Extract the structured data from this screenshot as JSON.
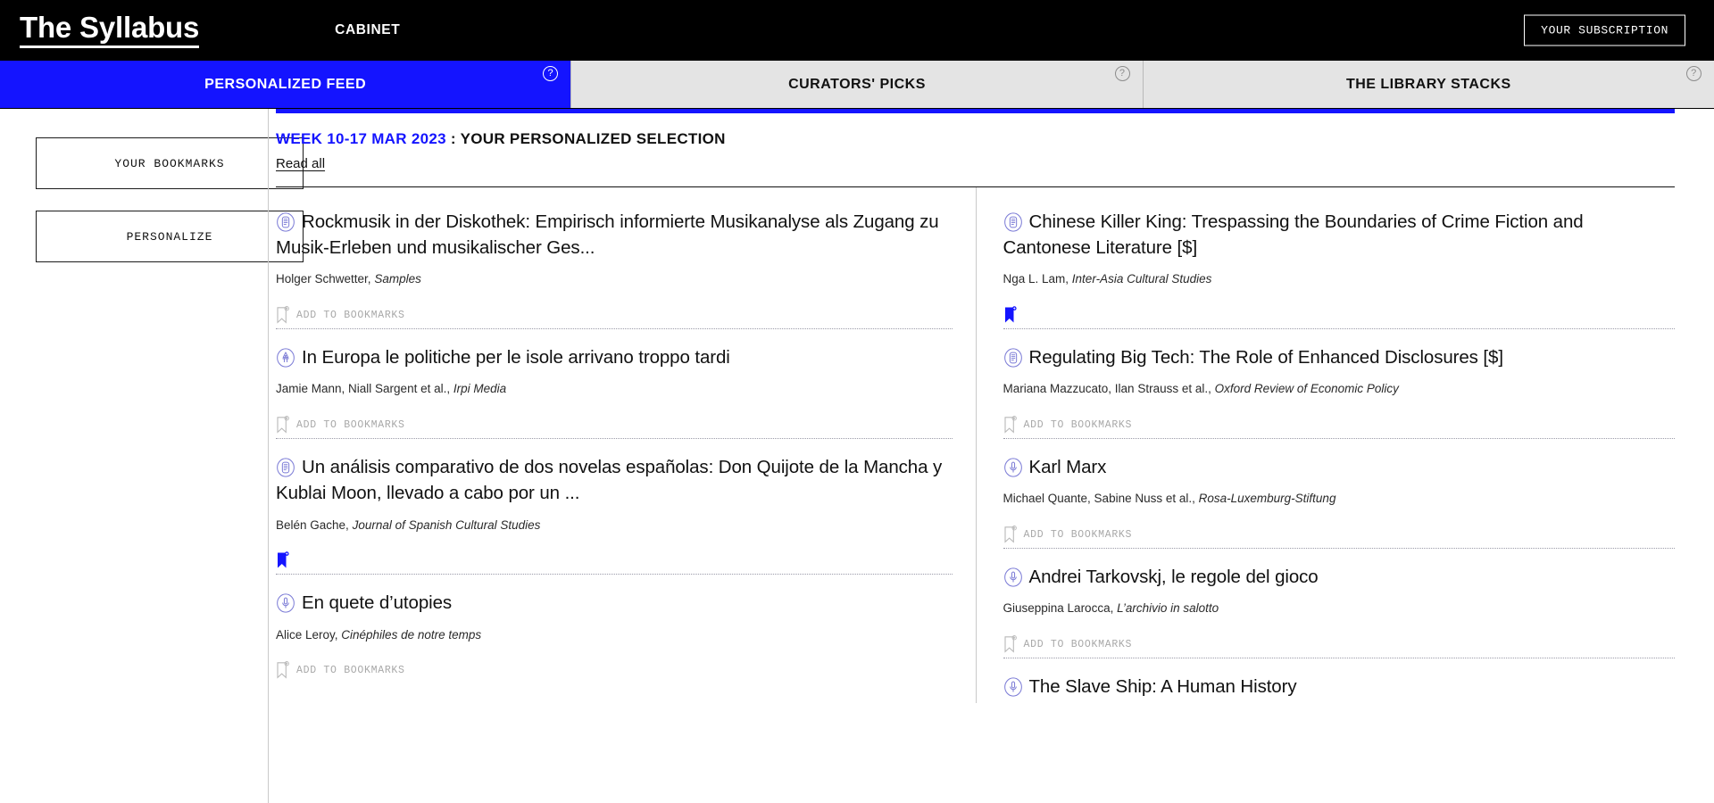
{
  "header": {
    "logo": "The Syllabus",
    "section": "CABINET",
    "subscription_label": "YOUR SUBSCRIPTION"
  },
  "tabs": [
    {
      "label": "PERSONALIZED FEED",
      "active": true,
      "help_glyph": "?"
    },
    {
      "label": "CURATORS' PICKS",
      "active": false,
      "help_glyph": "?"
    },
    {
      "label": "THE LIBRARY STACKS",
      "active": false,
      "help_glyph": "?"
    }
  ],
  "sidebar": {
    "items": [
      {
        "label": "YOUR BOOKMARKS"
      },
      {
        "label": "PERSONALIZE"
      }
    ]
  },
  "feed": {
    "week": "WEEK 10-17 MAR 2023",
    "heading_rest": " : YOUR PERSONALIZED SELECTION",
    "read_all": "Read all",
    "bookmark_label": "ADD TO BOOKMARKS",
    "accent_color": "#1414ff",
    "icon_color": "#7b7bd6",
    "columns": [
      {
        "items": [
          {
            "icon": "document-icon",
            "title": "Rockmusik in der Diskothek: Empirisch informierte Musikanalyse als Zugang zu Musik-Erleben und musikalischer Ges...",
            "authors": "Holger Schwetter, ",
            "publication": "Samples",
            "bookmarked": false
          },
          {
            "icon": "pen-nib-icon",
            "title": "In Europa le politiche per le isole arrivano troppo tardi",
            "authors": "Jamie Mann, Niall Sargent et al., ",
            "publication": "Irpi Media",
            "bookmarked": false
          },
          {
            "icon": "document-icon",
            "title": "Un análisis comparativo de dos novelas españolas: Don Quijote de la Mancha y Kublai Moon, llevado a cabo por un ...",
            "authors": "Belén Gache, ",
            "publication": "Journal of Spanish Cultural Studies",
            "bookmarked": true
          },
          {
            "icon": "microphone-icon",
            "title": "En quete d’utopies",
            "authors": "Alice Leroy, ",
            "publication": "Cinéphiles de notre temps",
            "bookmarked": false
          }
        ]
      },
      {
        "items": [
          {
            "icon": "document-icon",
            "title": "Chinese Killer King: Trespassing the Boundaries of Crime Fiction and Cantonese Literature [$]",
            "authors": "Nga L. Lam, ",
            "publication": "Inter-Asia Cultural Studies",
            "bookmarked": true
          },
          {
            "icon": "document-icon",
            "title": "Regulating Big Tech: The Role of Enhanced Disclosures [$]",
            "authors": "Mariana Mazzucato, Ilan Strauss et al., ",
            "publication": "Oxford Review of Economic Policy",
            "bookmarked": false
          },
          {
            "icon": "microphone-icon",
            "title": "Karl Marx",
            "authors": "Michael Quante, Sabine Nuss et al., ",
            "publication": "Rosa-Luxemburg-Stiftung",
            "bookmarked": false
          },
          {
            "icon": "microphone-icon",
            "title": "Andrei Tarkovskj, le regole del gioco",
            "authors": "Giuseppina Larocca, ",
            "publication": "L’archivio in salotto",
            "bookmarked": false
          },
          {
            "icon": "microphone-icon",
            "title": "The Slave Ship: A Human History",
            "authors": "",
            "publication": "",
            "bookmarked": false
          }
        ]
      }
    ]
  }
}
